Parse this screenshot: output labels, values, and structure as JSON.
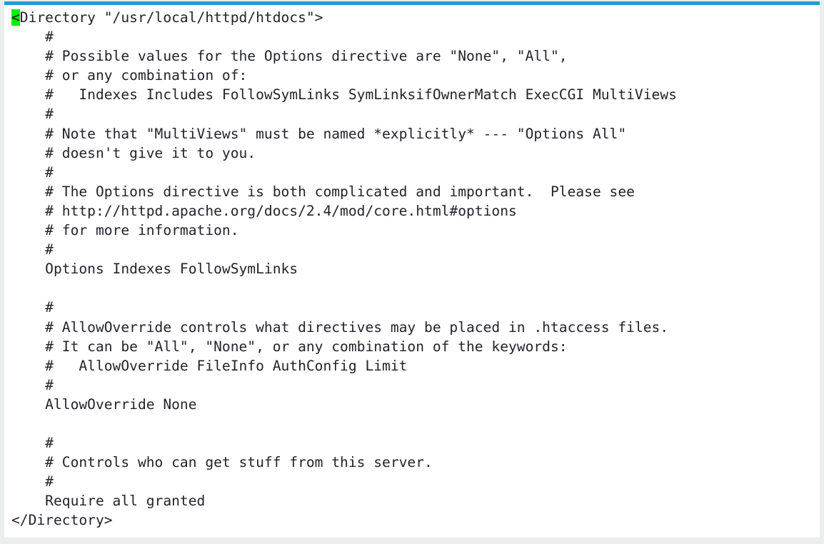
{
  "window": {
    "kind": "text-editor-config-view",
    "accent_color": "#1f9ad6",
    "background_color": "#eceded",
    "page_color": "#ffffff",
    "text_color": "#22242c",
    "cursor_highlight_color": "#00ef00"
  },
  "editor": {
    "cursor": {
      "character": "<",
      "line_index": 0,
      "column_index": 0
    },
    "lines": [
      "<Directory \"/usr/local/httpd/htdocs\">",
      "    #",
      "    # Possible values for the Options directive are \"None\", \"All\",",
      "    # or any combination of:",
      "    #   Indexes Includes FollowSymLinks SymLinksifOwnerMatch ExecCGI MultiViews",
      "    #",
      "    # Note that \"MultiViews\" must be named *explicitly* --- \"Options All\"",
      "    # doesn't give it to you.",
      "    #",
      "    # The Options directive is both complicated and important.  Please see",
      "    # http://httpd.apache.org/docs/2.4/mod/core.html#options",
      "    # for more information.",
      "    #",
      "    Options Indexes FollowSymLinks",
      "",
      "    #",
      "    # AllowOverride controls what directives may be placed in .htaccess files.",
      "    # It can be \"All\", \"None\", or any combination of the keywords:",
      "    #   AllowOverride FileInfo AuthConfig Limit",
      "    #",
      "    AllowOverride None",
      "",
      "    #",
      "    # Controls who can get stuff from this server.",
      "    #",
      "    Require all granted",
      "</Directory>"
    ]
  }
}
